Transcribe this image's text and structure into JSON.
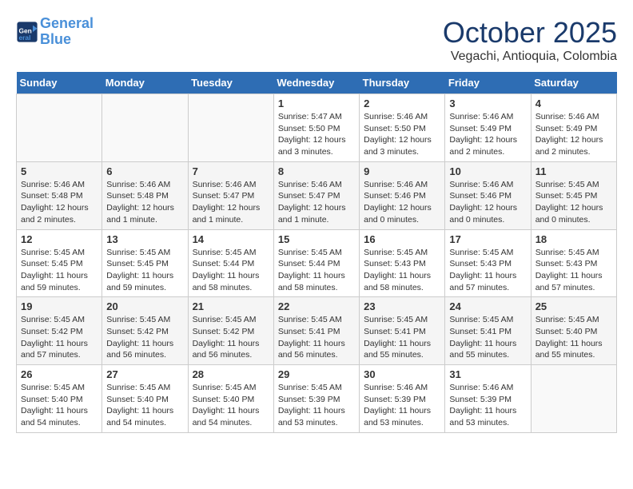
{
  "header": {
    "logo_line1": "General",
    "logo_line2": "Blue",
    "month_title": "October 2025",
    "location": "Vegachi, Antioquia, Colombia"
  },
  "weekdays": [
    "Sunday",
    "Monday",
    "Tuesday",
    "Wednesday",
    "Thursday",
    "Friday",
    "Saturday"
  ],
  "weeks": [
    [
      {
        "day": "",
        "info": ""
      },
      {
        "day": "",
        "info": ""
      },
      {
        "day": "",
        "info": ""
      },
      {
        "day": "1",
        "info": "Sunrise: 5:47 AM\nSunset: 5:50 PM\nDaylight: 12 hours\nand 3 minutes."
      },
      {
        "day": "2",
        "info": "Sunrise: 5:46 AM\nSunset: 5:50 PM\nDaylight: 12 hours\nand 3 minutes."
      },
      {
        "day": "3",
        "info": "Sunrise: 5:46 AM\nSunset: 5:49 PM\nDaylight: 12 hours\nand 2 minutes."
      },
      {
        "day": "4",
        "info": "Sunrise: 5:46 AM\nSunset: 5:49 PM\nDaylight: 12 hours\nand 2 minutes."
      }
    ],
    [
      {
        "day": "5",
        "info": "Sunrise: 5:46 AM\nSunset: 5:48 PM\nDaylight: 12 hours\nand 2 minutes."
      },
      {
        "day": "6",
        "info": "Sunrise: 5:46 AM\nSunset: 5:48 PM\nDaylight: 12 hours\nand 1 minute."
      },
      {
        "day": "7",
        "info": "Sunrise: 5:46 AM\nSunset: 5:47 PM\nDaylight: 12 hours\nand 1 minute."
      },
      {
        "day": "8",
        "info": "Sunrise: 5:46 AM\nSunset: 5:47 PM\nDaylight: 12 hours\nand 1 minute."
      },
      {
        "day": "9",
        "info": "Sunrise: 5:46 AM\nSunset: 5:46 PM\nDaylight: 12 hours\nand 0 minutes."
      },
      {
        "day": "10",
        "info": "Sunrise: 5:46 AM\nSunset: 5:46 PM\nDaylight: 12 hours\nand 0 minutes."
      },
      {
        "day": "11",
        "info": "Sunrise: 5:45 AM\nSunset: 5:45 PM\nDaylight: 12 hours\nand 0 minutes."
      }
    ],
    [
      {
        "day": "12",
        "info": "Sunrise: 5:45 AM\nSunset: 5:45 PM\nDaylight: 11 hours\nand 59 minutes."
      },
      {
        "day": "13",
        "info": "Sunrise: 5:45 AM\nSunset: 5:45 PM\nDaylight: 11 hours\nand 59 minutes."
      },
      {
        "day": "14",
        "info": "Sunrise: 5:45 AM\nSunset: 5:44 PM\nDaylight: 11 hours\nand 58 minutes."
      },
      {
        "day": "15",
        "info": "Sunrise: 5:45 AM\nSunset: 5:44 PM\nDaylight: 11 hours\nand 58 minutes."
      },
      {
        "day": "16",
        "info": "Sunrise: 5:45 AM\nSunset: 5:43 PM\nDaylight: 11 hours\nand 58 minutes."
      },
      {
        "day": "17",
        "info": "Sunrise: 5:45 AM\nSunset: 5:43 PM\nDaylight: 11 hours\nand 57 minutes."
      },
      {
        "day": "18",
        "info": "Sunrise: 5:45 AM\nSunset: 5:43 PM\nDaylight: 11 hours\nand 57 minutes."
      }
    ],
    [
      {
        "day": "19",
        "info": "Sunrise: 5:45 AM\nSunset: 5:42 PM\nDaylight: 11 hours\nand 57 minutes."
      },
      {
        "day": "20",
        "info": "Sunrise: 5:45 AM\nSunset: 5:42 PM\nDaylight: 11 hours\nand 56 minutes."
      },
      {
        "day": "21",
        "info": "Sunrise: 5:45 AM\nSunset: 5:42 PM\nDaylight: 11 hours\nand 56 minutes."
      },
      {
        "day": "22",
        "info": "Sunrise: 5:45 AM\nSunset: 5:41 PM\nDaylight: 11 hours\nand 56 minutes."
      },
      {
        "day": "23",
        "info": "Sunrise: 5:45 AM\nSunset: 5:41 PM\nDaylight: 11 hours\nand 55 minutes."
      },
      {
        "day": "24",
        "info": "Sunrise: 5:45 AM\nSunset: 5:41 PM\nDaylight: 11 hours\nand 55 minutes."
      },
      {
        "day": "25",
        "info": "Sunrise: 5:45 AM\nSunset: 5:40 PM\nDaylight: 11 hours\nand 55 minutes."
      }
    ],
    [
      {
        "day": "26",
        "info": "Sunrise: 5:45 AM\nSunset: 5:40 PM\nDaylight: 11 hours\nand 54 minutes."
      },
      {
        "day": "27",
        "info": "Sunrise: 5:45 AM\nSunset: 5:40 PM\nDaylight: 11 hours\nand 54 minutes."
      },
      {
        "day": "28",
        "info": "Sunrise: 5:45 AM\nSunset: 5:40 PM\nDaylight: 11 hours\nand 54 minutes."
      },
      {
        "day": "29",
        "info": "Sunrise: 5:45 AM\nSunset: 5:39 PM\nDaylight: 11 hours\nand 53 minutes."
      },
      {
        "day": "30",
        "info": "Sunrise: 5:46 AM\nSunset: 5:39 PM\nDaylight: 11 hours\nand 53 minutes."
      },
      {
        "day": "31",
        "info": "Sunrise: 5:46 AM\nSunset: 5:39 PM\nDaylight: 11 hours\nand 53 minutes."
      },
      {
        "day": "",
        "info": ""
      }
    ]
  ]
}
